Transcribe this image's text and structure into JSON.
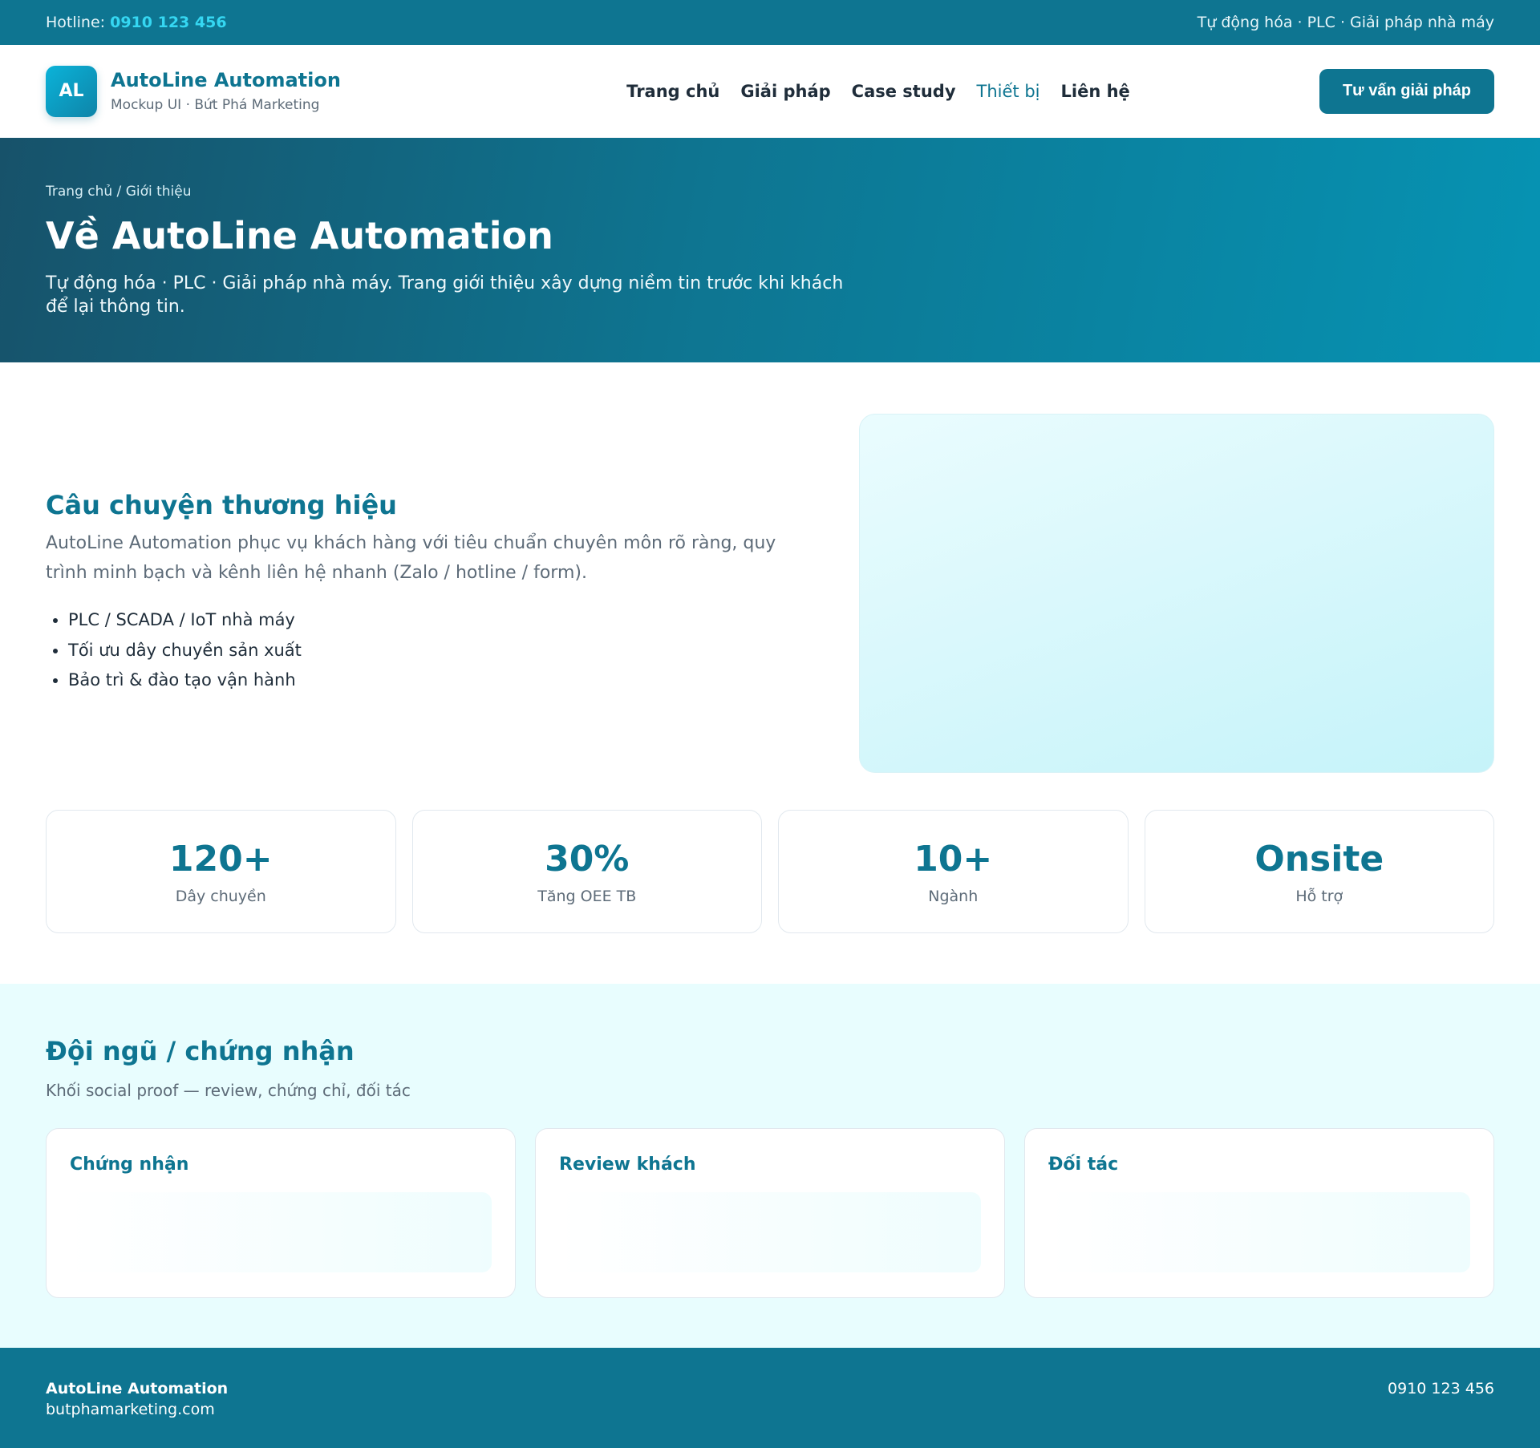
{
  "topbar": {
    "hotline_label": "Hotline:",
    "hotline_number": "0910 123 456",
    "tagline": "Tự động hóa · PLC · Giải pháp nhà máy"
  },
  "header": {
    "logo_text": "AL",
    "brand_name": "AutoLine Automation",
    "brand_sub": "Mockup UI · Bứt Phá Marketing",
    "nav": [
      {
        "label": "Trang chủ"
      },
      {
        "label": "Giải pháp"
      },
      {
        "label": "Case study"
      },
      {
        "label": "Thiết bị"
      },
      {
        "label": "Liên hệ"
      }
    ],
    "cta_label": "Tư vấn giải pháp"
  },
  "hero": {
    "breadcrumb": "Trang chủ / Giới thiệu",
    "title": "Về AutoLine Automation",
    "description": "Tự động hóa · PLC · Giải pháp nhà máy. Trang giới thiệu xây dựng niềm tin trước khi khách để lại thông tin."
  },
  "story": {
    "title": "Câu chuyện thương hiệu",
    "text": "AutoLine Automation phục vụ khách hàng với tiêu chuẩn chuyên môn rõ ràng, quy trình minh bạch và kênh liên hệ nhanh (Zalo / hotline / form).",
    "bullets": [
      "PLC / SCADA / IoT nhà máy",
      "Tối ưu dây chuyền sản xuất",
      "Bảo trì & đào tạo vận hành"
    ]
  },
  "stats": [
    {
      "value": "120+",
      "label": "Dây chuyền"
    },
    {
      "value": "30%",
      "label": "Tăng OEE TB"
    },
    {
      "value": "10+",
      "label": "Ngành"
    },
    {
      "value": "Onsite",
      "label": "Hỗ trợ"
    }
  ],
  "team": {
    "title": "Đội ngũ / chứng nhận",
    "subtitle": "Khối social proof — review, chứng chỉ, đối tác",
    "cards": [
      {
        "title": "Chứng nhận"
      },
      {
        "title": "Review khách"
      },
      {
        "title": "Đối tác"
      }
    ]
  },
  "footer": {
    "name": "AutoLine Automation",
    "site": "butphamarketing.com",
    "phone": "0910 123 456"
  },
  "colors": {
    "primary": "#0e7591",
    "accent": "#35d7f2",
    "team_bg": "#e8fdfe"
  }
}
